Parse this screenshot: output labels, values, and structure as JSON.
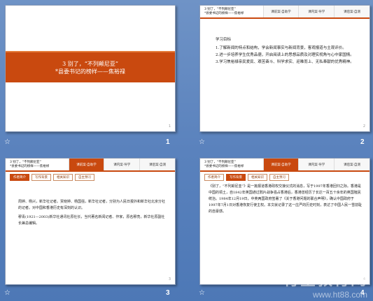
{
  "slides": [
    {
      "number": "1",
      "banner_line1": "3  别了，“不列颠尼亚”",
      "banner_line2": "*县委书记的榜样——焦裕禄",
      "page": "1"
    },
    {
      "number": "2",
      "header_title_line1": "3  别了，“不列颠尼亚”",
      "header_title_line2": "*县委书记的榜样——焦裕禄",
      "tabs": [
        "课前案·自助学",
        "课内案·导学",
        "课后案·自测"
      ],
      "heading": "学习目标",
      "items": [
        "1.了解新闻的特点和结构，学会新闻事实与新闻背景，客观报道与主观评价。",
        "2.进一步培养学生优秀品德，开启阅读上的思想品质及对理实视角与心中家国情。",
        "3.学习焦裕禄亲民爱民、艰苦奋斗、科学求实、迎难而上、无私奉献的优秀精神。"
      ],
      "page": "2"
    },
    {
      "number": "3",
      "header_title_line1": "3  别了，“不列颠尼亚”",
      "header_title_line2": "*县委书记的榜样——焦裕禄",
      "tabs": [
        "课前案·自助学",
        "课内案·导学",
        "课后案·自测"
      ],
      "subtabs": [
        "作者简介",
        "写作背景",
        "相关知识",
        "自主预习"
      ],
      "paragraphs": [
        "周婷、杨兴，新华社记者。贾晓婷、杨国强，新华社记者，分别为人民日报外和新华社北京分社的记者。对中国和香港历史有深刻的认识。",
        "穆青(1921—2003)新华社通讯社原社长，当代著名新闻记者、作家，原名穆亮，新华社原副社长兼总编辑。"
      ],
      "page": "3"
    },
    {
      "number": "4",
      "header_title_line1": "3  别了，“不列颠尼亚”",
      "header_title_line2": "*县委书记的榜样——焦裕禄",
      "tabs": [
        "课前案·自助学",
        "课内案·导学",
        "课后案·自测"
      ],
      "subtabs": [
        "作者简介",
        "写作背景",
        "相关知识",
        "自主预习"
      ],
      "paragraph": "《别了，“不列颠尼亚”》是一篇报道香港政权交接仪式的消息，写于1997年香港回归之际。香港是中国的领土，自1842年英国通过鸦片战争强占香港后，香港曾经历了长达一百五十余年的英国殖民统治。1984年12月19日，中英两国政府签署了《关于香港问题的联合声明》，确认中国政府于1997年7月1日对香港恢复行使主权。本文就记录了这一庄严的历史时刻，表达了中国人民一雪前耻的自豪感。",
      "page": "4"
    }
  ],
  "watermark": {
    "line1": "育星教育网",
    "line2": "www.ht88.com"
  },
  "icons": {
    "star": "☆"
  }
}
